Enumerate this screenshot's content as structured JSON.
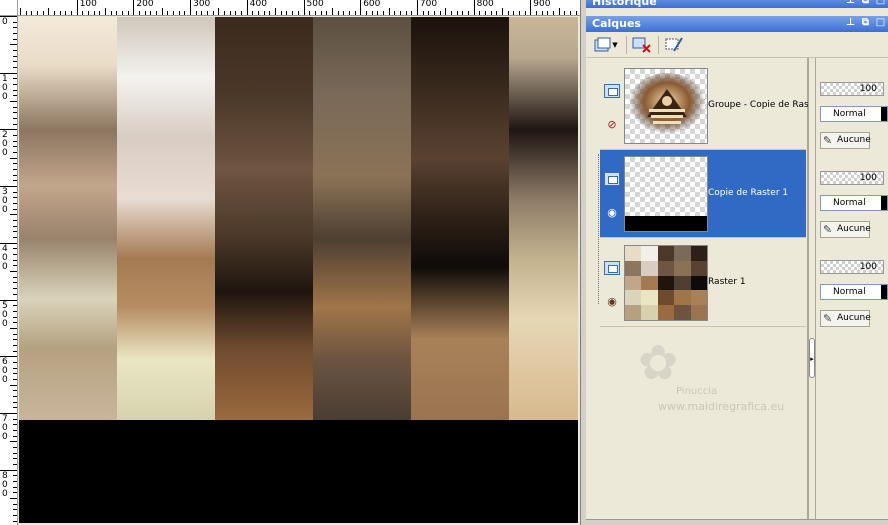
{
  "rulers": {
    "top_labels": [
      "100",
      "200",
      "300",
      "400",
      "500",
      "600",
      "700",
      "800",
      "900"
    ],
    "left_labels": [
      "0",
      "100",
      "200",
      "300",
      "400",
      "500",
      "600",
      "700",
      "800"
    ]
  },
  "panels": {
    "history": {
      "title": "Historique"
    },
    "layers": {
      "title": "Calques"
    }
  },
  "layers": [
    {
      "name": "Groupe - Copie de Raster 1",
      "opacity": "100",
      "blend_mode": "Normal",
      "mask": "Aucune",
      "visible": false,
      "selected": false
    },
    {
      "name": "Copie de Raster 1",
      "opacity": "100",
      "blend_mode": "Normal",
      "mask": "Aucune",
      "visible": true,
      "selected": true
    },
    {
      "name": "Raster 1",
      "opacity": "100",
      "blend_mode": "Normal",
      "mask": "Aucune",
      "visible": true,
      "selected": false
    }
  ],
  "watermark": {
    "author": "Pinuccia",
    "site": "www.maidiregrafica.eu"
  },
  "icons": {
    "title_buttons": [
      "pin-icon",
      "restore-icon",
      "close-icon"
    ],
    "toolbar": [
      "new-layer-icon",
      "delete-layer-icon",
      "layer-properties-icon"
    ]
  },
  "colors": {
    "title_bar": "#3b6fd6",
    "selected_row": "#316ac5",
    "panel_bg": "#ece9d8"
  }
}
